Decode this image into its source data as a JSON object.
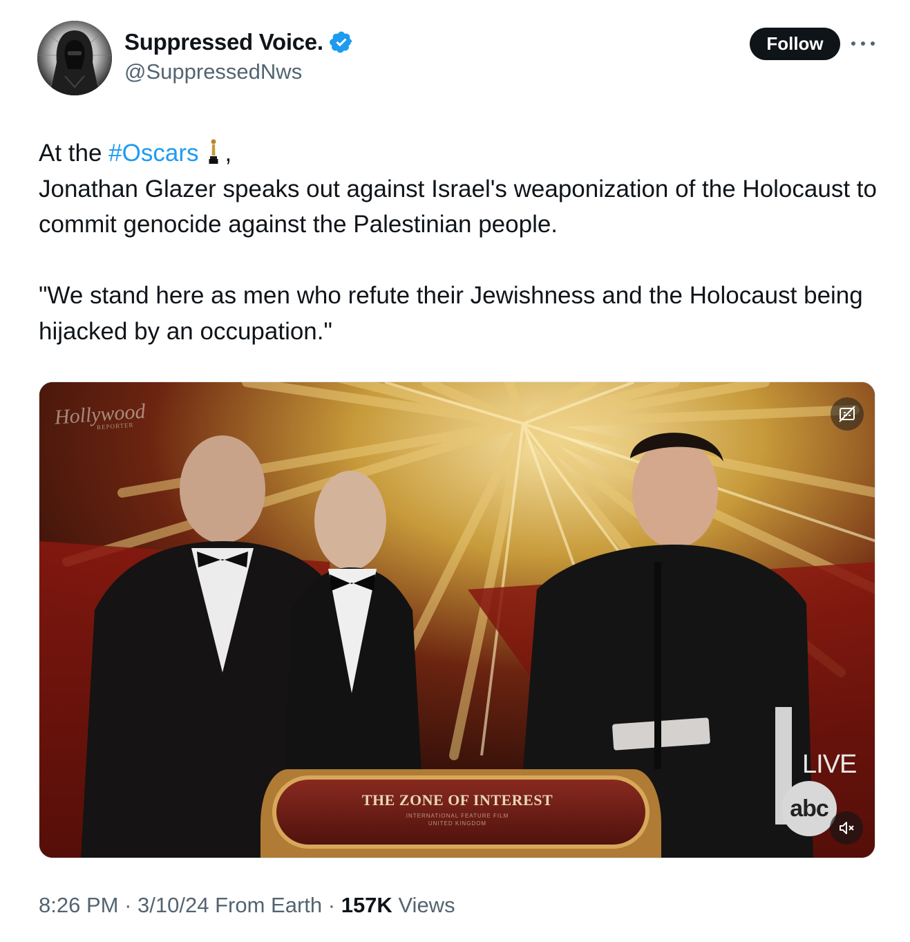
{
  "author": {
    "display_name": "Suppressed Voice.",
    "handle": "@SuppressedNws",
    "verified": true
  },
  "actions": {
    "follow_label": "Follow"
  },
  "tweet": {
    "line1_prefix": "At the ",
    "hashtag": "#Oscars",
    "line1_suffix": ",",
    "paragraph1": "Jonathan Glazer speaks out against Israel's weaponization of the Holocaust to commit genocide against the Palestinian people.",
    "paragraph2": "\"We stand here as men who refute their Jewishness and the Holocaust being hijacked by an occupation.\""
  },
  "media": {
    "watermark": "Hollywood",
    "watermark_sub": "REPORTER",
    "podium_title": "THE ZONE OF INTEREST",
    "podium_sub_1": "INTERNATIONAL FEATURE FILM",
    "podium_sub_2": "UNITED KINGDOM",
    "live_label": "LIVE",
    "network_logo": "abc"
  },
  "footer": {
    "time": "8:26 PM",
    "sep": "·",
    "date": "3/10/24",
    "source": "From Earth",
    "views_count": "157K",
    "views_label": "Views"
  },
  "colors": {
    "accent": "#1d9bf0",
    "text": "#0f1419",
    "secondary": "#536471"
  }
}
